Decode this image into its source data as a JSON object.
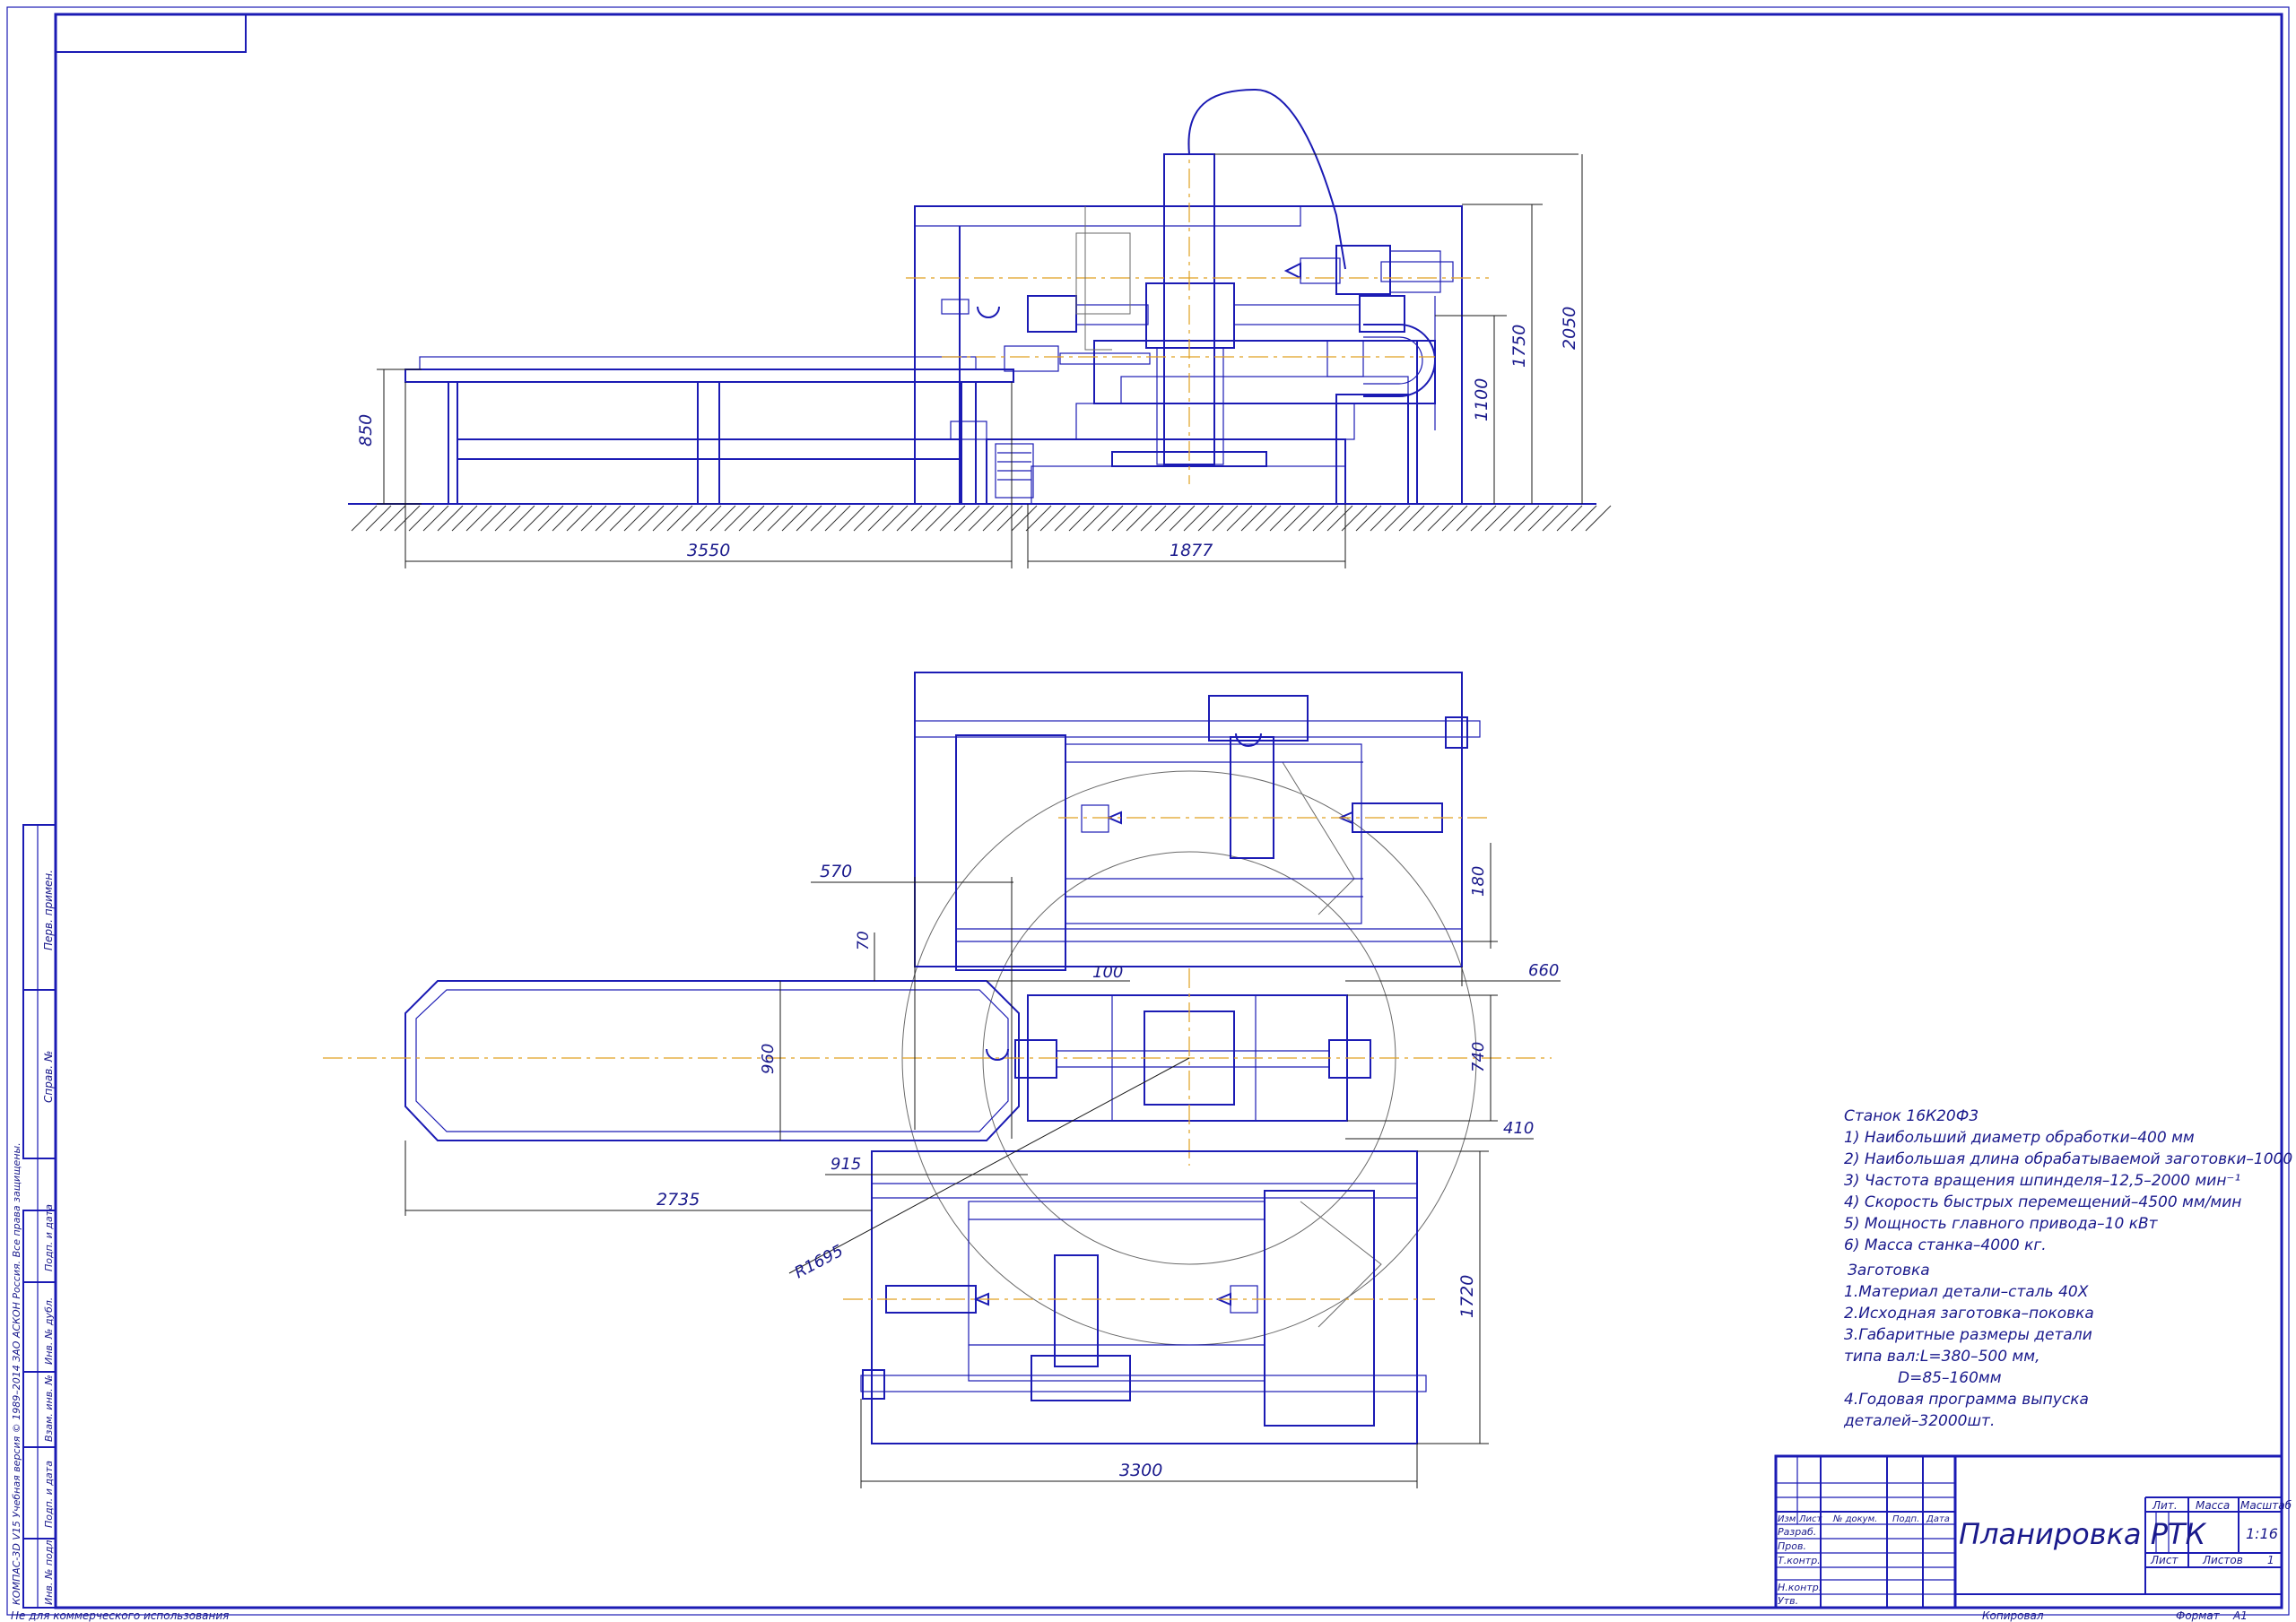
{
  "dimensions": {
    "top_view": {
      "table_height": "850",
      "table_length": "3550",
      "machine_length": "1877",
      "height_1100": "1100",
      "height_1750": "1750",
      "height_2050": "2050"
    },
    "plan_view": {
      "d570": "570",
      "d180": "180",
      "d70": "70",
      "d100": "100",
      "d660": "660",
      "d960": "960",
      "d740": "740",
      "d410": "410",
      "d915": "915",
      "d2735": "2735",
      "radius": "R1695",
      "d1720": "1720",
      "d3300": "3300"
    }
  },
  "spec": {
    "title": "Станок 16К20Ф3",
    "items": [
      "1) Наибольший диаметр обработки–400 мм",
      "2) Наибольшая длина обрабатываемой заготовки–1000 мм",
      "3) Частота вращения шпинделя–12,5–2000 мин⁻¹",
      "4) Скорость быстрых перемещений–4500 мм/мин",
      "5) Мощность главного привода–10 кВт",
      "6) Масса станка–4000 кг."
    ]
  },
  "workpiece": {
    "title": "Заготовка",
    "items": [
      "1.Материал детали–сталь 40Х",
      "2.Исходная заготовка–поковка",
      "3.Габаритные размеры детали",
      "типа вал:L=380–500 мм,",
      "D=85–160мм",
      "4.Годовая программа выпуска",
      "деталей–32000шт."
    ]
  },
  "title_block": {
    "drawing_name": "Планировка РТК",
    "col_headers": [
      "Изм",
      "Лист",
      "№ докум.",
      "Подп.",
      "Дата"
    ],
    "rows": [
      "Разраб.",
      "Пров.",
      "Т.контр.",
      "Н.контр.",
      "Утв."
    ],
    "lit": "Лит.",
    "massa": "Масса",
    "masshtab": "Масштаб",
    "scale": "1:16",
    "list": "Лист",
    "listov": "Листов",
    "listov_value": "1",
    "kopiroval": "Копировал",
    "format_label": "Формат",
    "format_value": "А1"
  },
  "side_stamp": {
    "perv_primen": "Перв. примен.",
    "sprav_no": "Справ. №",
    "podp_data_1": "Подп. и дата",
    "inv_dubl": "Инв. № дубл.",
    "vzam_inv": "Взам. инв. №",
    "podp_data_2": "Подп. и дата",
    "inv_podl": "Инв. № подл."
  },
  "footer": {
    "left_note": "Не для коммерческого использования",
    "vertical_note": "КОМПАС-3D V15 Учебная версия © 1989–2014 ЗАО АСКОН Россия. Все права защищены."
  }
}
